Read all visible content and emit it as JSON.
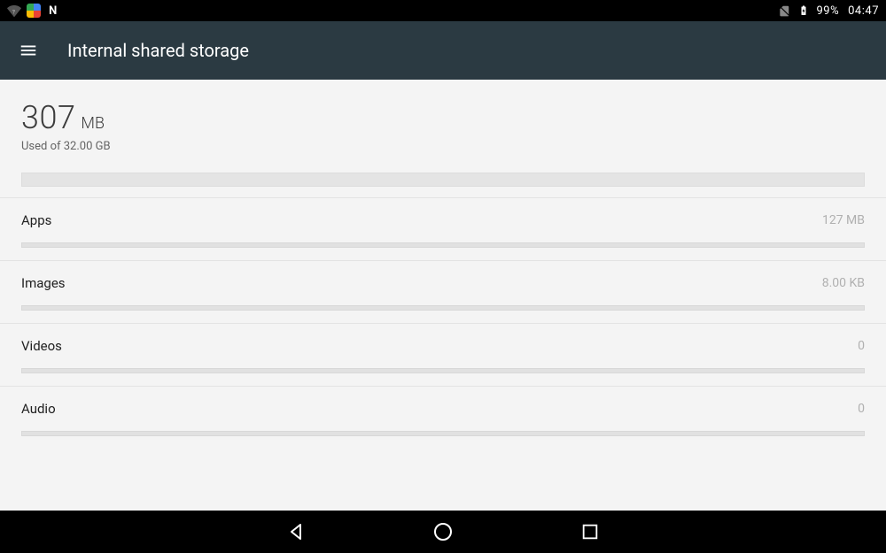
{
  "status": {
    "battery_pct": "99%",
    "time": "04:47",
    "n_label": "N"
  },
  "appbar": {
    "title": "Internal shared storage"
  },
  "summary": {
    "value": "307",
    "unit": "MB",
    "sub": "Used of 32.00 GB"
  },
  "categories": [
    {
      "name": "Apps",
      "size": "127 MB"
    },
    {
      "name": "Images",
      "size": "8.00 KB"
    },
    {
      "name": "Videos",
      "size": "0"
    },
    {
      "name": "Audio",
      "size": "0"
    }
  ]
}
